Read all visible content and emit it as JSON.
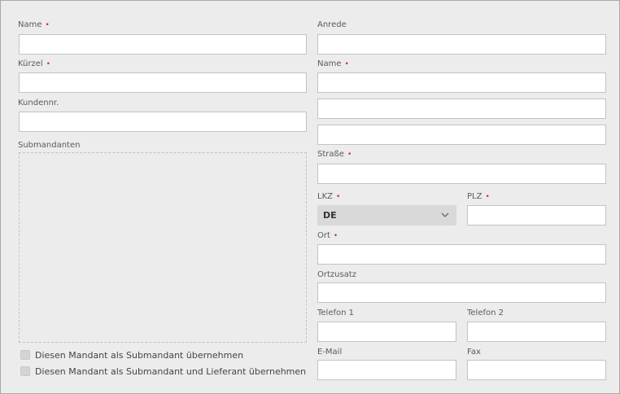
{
  "left": {
    "name_label": "Name",
    "kuerzel_label": "Kürzel",
    "kundennr_label": "Kundennr.",
    "submandanten_label": "Submandanten",
    "checkbox1_label": "Diesen Mandant als Submandant übernehmen",
    "checkbox2_label": "Diesen Mandant als Submandant und Lieferant übernehmen"
  },
  "right": {
    "anrede_label": "Anrede",
    "name_label": "Name",
    "strasse_label": "Straße",
    "lkz_label": "LKZ",
    "lkz_value": "DE",
    "plz_label": "PLZ",
    "ort_label": "Ort",
    "ortzusatz_label": "Ortzusatz",
    "telefon1_label": "Telefon 1",
    "telefon2_label": "Telefon 2",
    "email_label": "E-Mail",
    "fax_label": "Fax"
  },
  "required_marker": "•",
  "colors": {
    "required": "#c0392b",
    "background": "#ececec",
    "input_border": "#c3c3c3"
  }
}
